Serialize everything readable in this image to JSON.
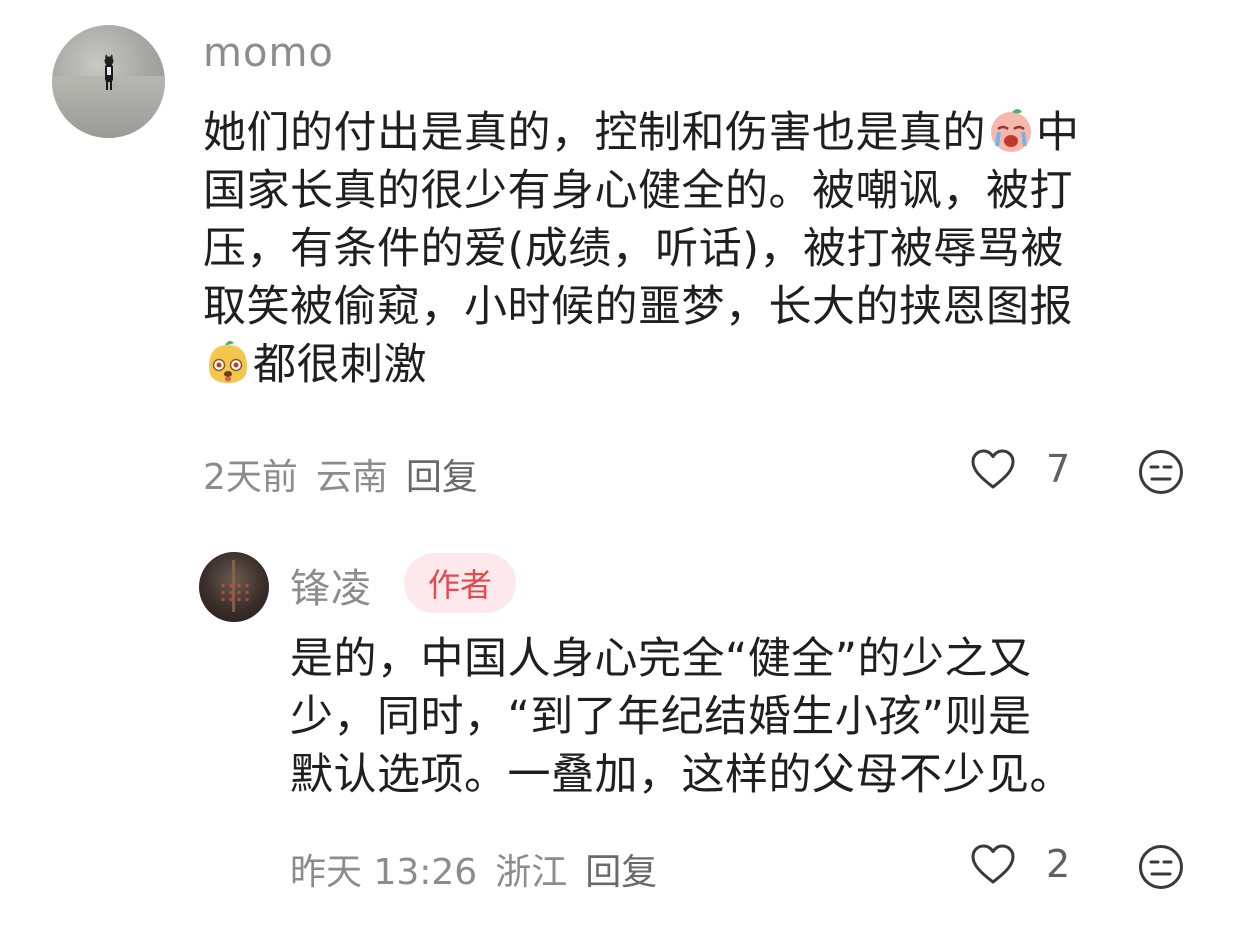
{
  "comments": [
    {
      "username": "momo",
      "text_line1": "她们的付出是真的，控制和伤害也是真的",
      "text_line1_tail": "中",
      "text_line2": "国家长真的很少有身心健全的。被嘲讽，被打",
      "text_line3": "压，有条件的爱(成绩，听话)，被打被辱骂被",
      "text_line4": "取笑被偷窥，小时候的噩梦，长大的挟恩图报",
      "text_line5": "都很刺激",
      "emoji_1": "crying-face-emoji",
      "emoji_2": "shocked-dog-emoji",
      "time": "2天前",
      "location": "云南",
      "reply_label": "回复",
      "likes": "7",
      "like_icon": "heart-outline-icon",
      "dislike_icon": "meh-face-icon"
    },
    {
      "username": "锋凌",
      "badge": "作者",
      "text_line1": "是的，中国人身心完全“健全”的少之又",
      "text_line2": "少，同时，“到了年纪结婚生小孩”则是",
      "text_line3": "默认选项。一叠加，这样的父母不少见。",
      "time": "昨天 13:26",
      "location": "浙江",
      "reply_label": "回复",
      "likes": "2",
      "like_icon": "heart-outline-icon",
      "dislike_icon": "meh-face-icon"
    }
  ],
  "colors": {
    "text": "#1f1f1f",
    "meta": "#8c8c8c",
    "badge_bg": "#fde9ec",
    "badge_text": "#e5484d"
  }
}
